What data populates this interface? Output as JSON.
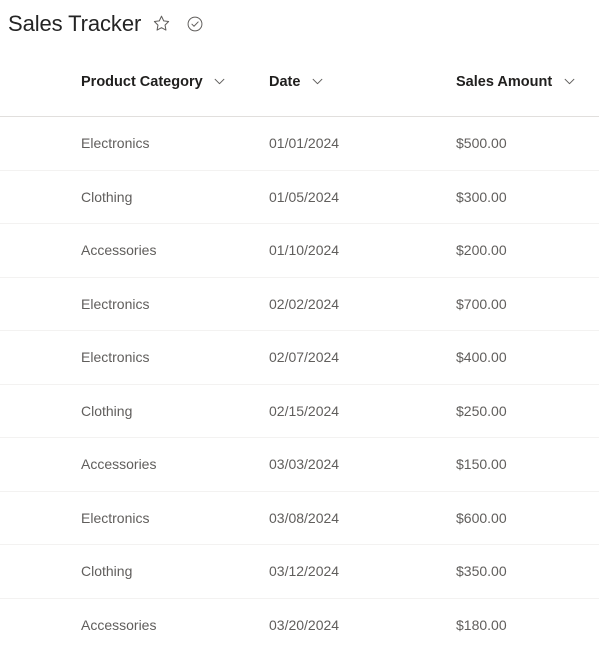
{
  "header": {
    "title": "Sales Tracker",
    "favorite_icon": "star-icon",
    "saved_status_icon": "check-circle-icon"
  },
  "colors": {
    "page_background": "#ffffff",
    "title_text": "#242424",
    "column_header_text": "#201f1e",
    "cell_text": "#605e5c",
    "header_divider": "#e1dfdd",
    "row_divider": "#f3f2f1",
    "icon_stroke": "#605e5c"
  },
  "table": {
    "columns": [
      {
        "label": "Product Category",
        "sort_icon": "chevron-down-icon"
      },
      {
        "label": "Date",
        "sort_icon": "chevron-down-icon"
      },
      {
        "label": "Sales Amount",
        "sort_icon": "chevron-down-icon"
      }
    ],
    "rows": [
      {
        "category": "Electronics",
        "date": "01/01/2024",
        "amount": "$500.00"
      },
      {
        "category": "Clothing",
        "date": "01/05/2024",
        "amount": "$300.00"
      },
      {
        "category": "Accessories",
        "date": "01/10/2024",
        "amount": "$200.00"
      },
      {
        "category": "Electronics",
        "date": "02/02/2024",
        "amount": "$700.00"
      },
      {
        "category": "Electronics",
        "date": "02/07/2024",
        "amount": "$400.00"
      },
      {
        "category": "Clothing",
        "date": "02/15/2024",
        "amount": "$250.00"
      },
      {
        "category": "Accessories",
        "date": "03/03/2024",
        "amount": "$150.00"
      },
      {
        "category": "Electronics",
        "date": "03/08/2024",
        "amount": "$600.00"
      },
      {
        "category": "Clothing",
        "date": "03/12/2024",
        "amount": "$350.00"
      },
      {
        "category": "Accessories",
        "date": "03/20/2024",
        "amount": "$180.00"
      }
    ]
  }
}
